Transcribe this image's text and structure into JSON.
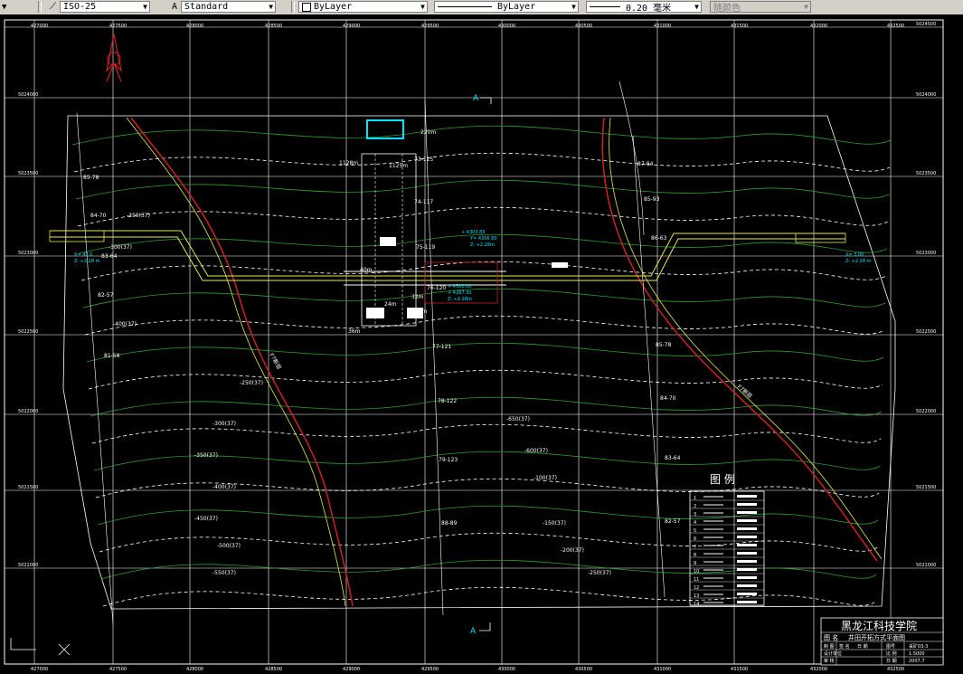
{
  "toolbar": {
    "dimstyle": "ISO-25",
    "textstyle": "Standard",
    "layer_color": "ByLayer",
    "linetype": "ByLayer",
    "lineweight": "0.20 毫米",
    "plotstyle": "随颜色"
  },
  "grid": {
    "x_labels": [
      "427000",
      "427500",
      "428000",
      "428500",
      "429000",
      "429500",
      "430000",
      "430500",
      "431000",
      "431500",
      "432000",
      "432500"
    ],
    "x_labels_bottom": [
      "427000",
      "427500",
      "428000",
      "428500",
      "429000",
      "429500",
      "430000",
      "430500",
      "431000",
      "431500",
      "432000",
      "432500"
    ],
    "y_labels_right": [
      "5024500",
      "5024000",
      "5023500",
      "5023000",
      "5022500",
      "5022000",
      "5021500",
      "5021000"
    ],
    "y_labels_left": [
      "5024000",
      "5023500",
      "5023000",
      "5022500",
      "5022000",
      "5021500",
      "5021000"
    ]
  },
  "section_marks": {
    "top": "A",
    "bottom": "A"
  },
  "contours": [
    "-250(37)",
    "-300(37)",
    "-350(37)",
    "-400(37)",
    "-450(37)",
    "-500(37)",
    "-550(37)",
    "-650(37)",
    "-600(37)",
    "-100(37)",
    "-150(37)",
    "-200(37)"
  ],
  "boreholes": [
    "85-78",
    "84-70",
    "83-64",
    "82-57",
    "81-58",
    "73-115",
    "74-117",
    "75-119",
    "76-120",
    "77-121",
    "78-122",
    "79-123",
    "88-89",
    "87-84",
    "85-93",
    "86-63"
  ],
  "faults": [
    "F7断层",
    "F7断层"
  ],
  "legend": {
    "title": "图 例",
    "rows": [
      "1",
      "2",
      "3",
      "4",
      "5",
      "6",
      "7",
      "8",
      "9",
      "10",
      "11",
      "12",
      "13",
      "14"
    ]
  },
  "title_block": {
    "institution": "黑龙江科技学院",
    "label_name": "图 名",
    "drawing_name": "井田开拓方式平面图",
    "row2": [
      "制 图",
      "签 名",
      "日 期",
      "图号",
      "采矿03-3"
    ],
    "row3_label": "设计单位",
    "scale_label": "比 例",
    "scale": "1:5000",
    "row4_label": "审 核",
    "date_label": "日 期",
    "date": "2007.7"
  },
  "annotations": [
    "220m",
    "1128m",
    "24m",
    "36m",
    "32m",
    "40m",
    "362m",
    "1125m"
  ],
  "colors": {
    "background": "#000000",
    "grid": "#ffffff",
    "contour": "#2e9e2e",
    "fault": "#cc2222",
    "cyan": "#00e5ff",
    "yellow": "#e8e84a"
  }
}
